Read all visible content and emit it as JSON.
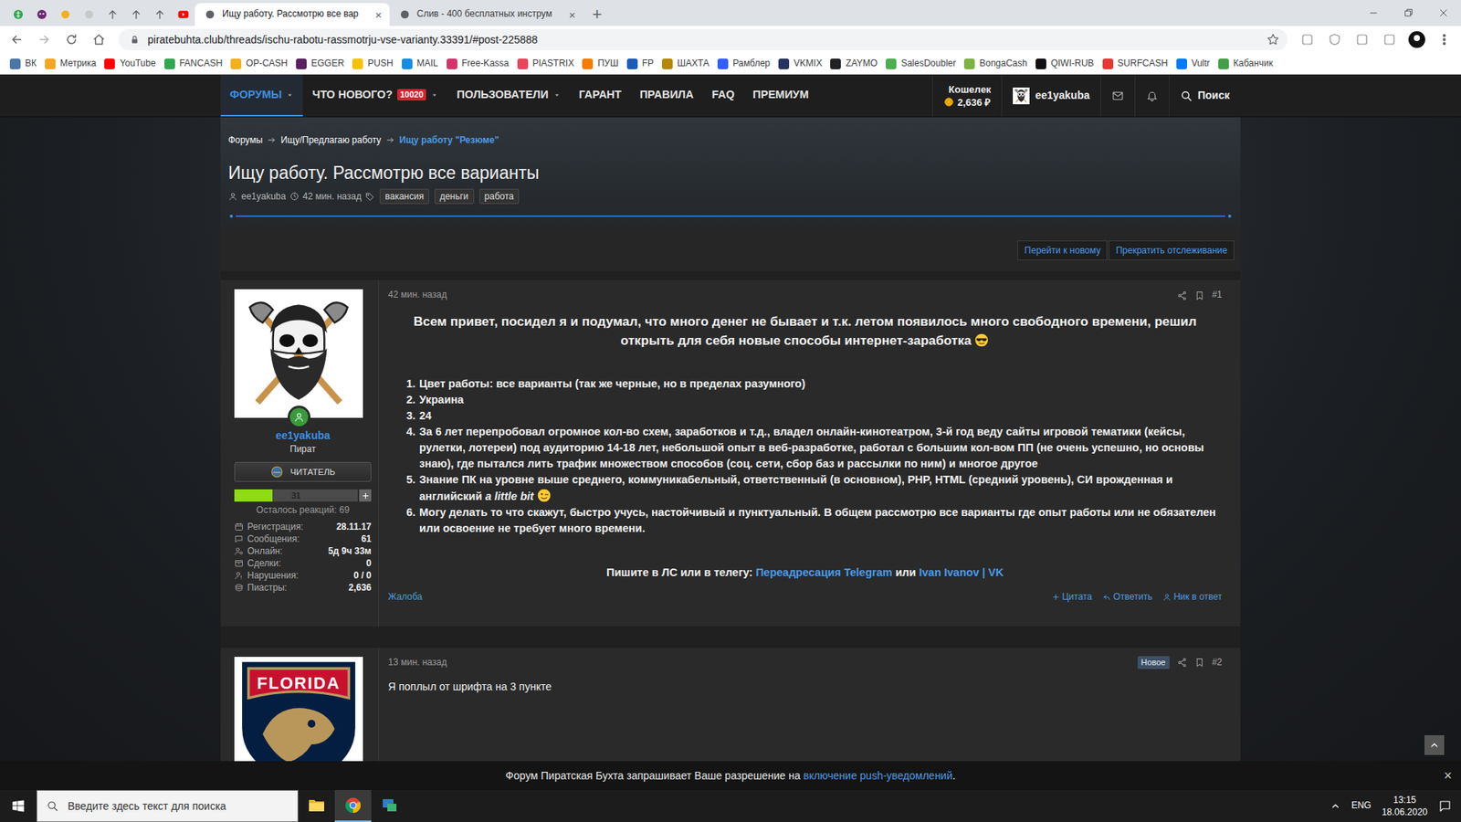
{
  "browser": {
    "pinned_tabs": [
      {
        "kind": "dollar",
        "color": "#2fa84f"
      },
      {
        "kind": "mask",
        "color": "#6b2a73"
      },
      {
        "kind": "dot",
        "color": "#f2b01e"
      },
      {
        "kind": "dot",
        "color": "#c9c9c9"
      },
      {
        "kind": "arrow",
        "color": "#5f6368"
      },
      {
        "kind": "arrow",
        "color": "#5f6368"
      },
      {
        "kind": "arrow",
        "color": "#5f6368"
      },
      {
        "kind": "play",
        "color": "#ff0000"
      }
    ],
    "tabs": [
      {
        "label": "Ищу работу. Рассмотрю все вар",
        "selected": true
      },
      {
        "label": "Слив - 400 бесплатных инструм",
        "selected": false
      }
    ],
    "tab_close": "×",
    "new_tab": "+",
    "url": "piratebuhta.club/threads/ischu-rabotu-rassmotrju-vse-varianty.33391/#post-225888",
    "bookmarks": [
      {
        "label": "ВК",
        "color": "#4a76a8"
      },
      {
        "label": "Метрика",
        "color": "#f5a623"
      },
      {
        "label": "YouTube",
        "color": "#ff0000"
      },
      {
        "label": "FANCASH",
        "color": "#2fa84f"
      },
      {
        "label": "OP-CASH",
        "color": "#f2b01e"
      },
      {
        "label": "EGGER",
        "color": "#5a1f5e"
      },
      {
        "label": "PUSH",
        "color": "#f4c20d"
      },
      {
        "label": "MAIL",
        "color": "#168de2"
      },
      {
        "label": "Free-Kassa",
        "color": "#d6336c"
      },
      {
        "label": "PIASTRIX",
        "color": "#e8455c"
      },
      {
        "label": "ПУШ",
        "color": "#f57c00"
      },
      {
        "label": "FP",
        "color": "#1e5bb8"
      },
      {
        "label": "ШАХТА",
        "color": "#b8860b"
      },
      {
        "label": "Рамблер",
        "color": "#315efb"
      },
      {
        "label": "VKMIX",
        "color": "#27355e"
      },
      {
        "label": "ZAYMO",
        "color": "#222222"
      },
      {
        "label": "SalesDoubler",
        "color": "#4caf50"
      },
      {
        "label": "BongaCash",
        "color": "#7cb342"
      },
      {
        "label": "QIWI-RUB",
        "color": "#111111"
      },
      {
        "label": "SURFCASH",
        "color": "#e53935"
      },
      {
        "label": "Vultr",
        "color": "#007bfc"
      },
      {
        "label": "Кабанчик",
        "color": "#43a047"
      }
    ]
  },
  "forum": {
    "nav": [
      {
        "label": "ФОРУМЫ",
        "selected": true,
        "dropdown": true
      },
      {
        "label": "ЧТО НОВОГО?",
        "selected": false,
        "dropdown": true,
        "badge": "10020"
      },
      {
        "label": "ПОЛЬЗОВАТЕЛИ",
        "selected": false,
        "dropdown": true
      },
      {
        "label": "ГАРАНТ",
        "selected": false,
        "dropdown": false
      },
      {
        "label": "ПРАВИЛА",
        "selected": false,
        "dropdown": false
      },
      {
        "label": "FAQ",
        "selected": false,
        "dropdown": false
      },
      {
        "label": "ПРЕМИУМ",
        "selected": false,
        "dropdown": false
      }
    ],
    "wallet": {
      "label": "Кошелек",
      "amount": "2,636 ₽"
    },
    "account": "ee1yakuba",
    "search": "Поиск",
    "breadcrumbs": [
      "Форумы",
      "Ищу/Предлагаю работу",
      "Ищу работу \"Резюме\""
    ],
    "thread": {
      "title": "Ищу работу. Рассмотрю все варианты",
      "author": "ee1yakuba",
      "time": "42 мин. назад",
      "tags": [
        "вакансия",
        "деньги",
        "работа"
      ]
    },
    "thread_buttons": [
      "Перейти к новому",
      "Прекратить отслеживание"
    ],
    "posts": [
      {
        "time": "42 мин. назад",
        "number": "#1",
        "new": false,
        "author": {
          "avatar": "skull",
          "online": true,
          "name": "ee1yakuba",
          "title": "Пират",
          "rank": "ЧИТАТЕЛЬ",
          "reactions": "31",
          "reactions_level": 0.31,
          "reactions_left": "Осталось реакций: 69",
          "stats": [
            {
              "kind": "registration",
              "label": "Регистрация:",
              "value": "28.11.17"
            },
            {
              "kind": "messages",
              "label": "Сообщения:",
              "value": "61"
            },
            {
              "kind": "online",
              "label": "Онлайн:",
              "value": "5д 9ч 33м"
            },
            {
              "kind": "deals",
              "label": "Сделки:",
              "value": "0"
            },
            {
              "kind": "violations",
              "label": "Нарушения:",
              "value": "0 / 0"
            },
            {
              "kind": "piastres",
              "label": "Пиастры:",
              "value": "2,636"
            }
          ]
        },
        "heading": [
          {
            "text": "Всем привет, посидел я и подумал, что много денег не бывает и т.к. летом появилось много свободного времени, решил открыть для себя новые способы интернет-заработка",
            "kind": "plain"
          },
          {
            "kind": "cool"
          }
        ],
        "list": [
          {
            "number": "1.",
            "segments": [
              {
                "text": "Цвет работы: все варианты (так же черные, но в пределах разумного)",
                "kind": "plain"
              }
            ]
          },
          {
            "number": "2.",
            "segments": [
              {
                "text": "Украина",
                "kind": "plain"
              }
            ]
          },
          {
            "number": "3.",
            "segments": [
              {
                "text": "24",
                "kind": "plain"
              }
            ]
          },
          {
            "number": "4.",
            "segments": [
              {
                "text": "За 6 лет перепробовал огромное кол-во схем, заработков и т.д., владел онлайн-кинотеатром, 3-й год веду сайты игровой тематики (кейсы, рулетки, лотереи) под аудиторию 14-18 лет, небольшой опыт в веб-разработке, работал с большим кол-вом ПП (не очень успешно, но основы знаю), где пытался лить трафик множеством способов (соц. сети, сбор баз и рассылки по ним) и многое другое",
                "kind": "plain"
              }
            ]
          },
          {
            "number": "5.",
            "segments": [
              {
                "text": "Знание ПК на уровне выше среднего, коммуникабельный, ответственный (в основном), PHP, HTML (средний уровень), СИ врожденная и английский ",
                "kind": "plain"
              },
              {
                "text": "a little bit",
                "kind": "italic"
              },
              {
                "kind": "wink"
              }
            ]
          },
          {
            "number": "6.",
            "segments": [
              {
                "text": "Могу делать то что скажут, быстро учусь, настойчивый и пунктуальный. В общем рассмотрю все варианты где опыт работы или не обязателен или освоение не требует много времени.",
                "kind": "plain"
              }
            ]
          }
        ],
        "contact": [
          {
            "text": "Пишите в ЛС или в телегу: ",
            "kind": "plain"
          },
          {
            "text": "Переадресация Telegram",
            "kind": "link"
          },
          {
            "text": " или ",
            "kind": "plain"
          },
          {
            "text": "Ivan Ivanov | VK",
            "kind": "link"
          }
        ],
        "report": "Жалоба",
        "actions": [
          "Цитата",
          "Ответить",
          "Ник в ответ"
        ]
      },
      {
        "time": "13 мин. назад",
        "number": "#2",
        "new": true,
        "new_label": "Новое",
        "author": {
          "avatar": "florida",
          "avatar_text": "FLORIDA"
        },
        "body": "Я поплыл от шрифта на 3 пункте"
      }
    ]
  },
  "push": {
    "segments": [
      {
        "text": "Форум Пиратская Бухта запрашивает Ваше разрешение на ",
        "kind": "plain"
      },
      {
        "text": "включение push-уведомлений",
        "kind": "link"
      },
      {
        "text": ".",
        "kind": "plain"
      }
    ],
    "close": "×"
  },
  "taskbar": {
    "search_placeholder": "Введите здесь текст для поиска",
    "apps": [
      {
        "kind": "explorer",
        "selected": false
      },
      {
        "kind": "chrome",
        "selected": true
      },
      {
        "kind": "app",
        "selected": false
      }
    ],
    "lang": "ENG",
    "time": "13:15",
    "date": "18.06.2020"
  }
}
